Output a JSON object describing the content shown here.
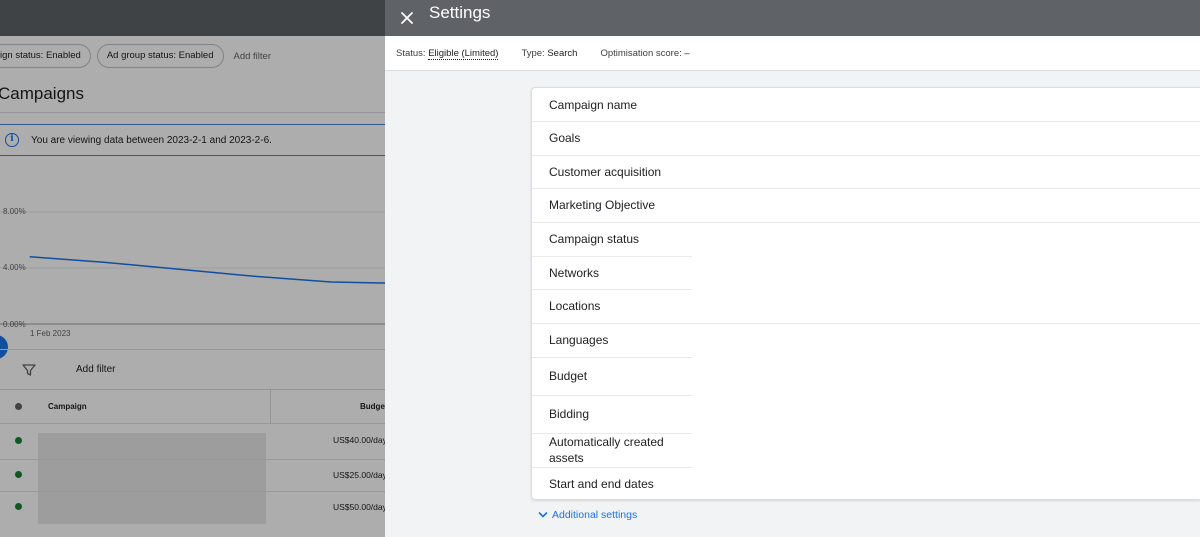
{
  "background": {
    "filters": [
      {
        "label": "Campaign status: Enabled",
        "display": "ign status: Enabled"
      },
      {
        "label": "Ad group status: Enabled",
        "display": "Ad group status: Enabled"
      }
    ],
    "add_filter_chip": "Add filter",
    "page_title": "Campaigns",
    "info_banner": "You are viewing data between 2023-2-1 and 2023-2-6.",
    "chart": {
      "yticks": [
        "8.00%",
        "4.00%",
        "0.00%"
      ],
      "xtick": "1 Feb 2023"
    },
    "table_toolbar": {
      "add_filter": "Add filter"
    },
    "table": {
      "headers": {
        "campaign": "Campaign",
        "budget": "Budget"
      },
      "rows": [
        {
          "budget": "US$40.00/day"
        },
        {
          "budget": "US$25.00/day"
        },
        {
          "budget": "US$50.00/day"
        }
      ]
    }
  },
  "chart_data": {
    "type": "line",
    "x": [
      "1 Feb 2023",
      "",
      "",
      "",
      "",
      ""
    ],
    "series": [
      {
        "values": [
          4.8,
          4.4,
          3.9,
          3.4,
          3.0,
          2.9
        ]
      }
    ],
    "ylim": [
      0,
      8
    ],
    "ylabel": "",
    "xlabel": "",
    "title": ""
  },
  "settings": {
    "title": "Settings",
    "status": {
      "label": "Status:",
      "value": "Eligible (Limited)"
    },
    "type": {
      "label": "Type:",
      "value": "Search"
    },
    "optimisation": {
      "label": "Optimisation score:",
      "value": "–"
    },
    "rows": [
      "Campaign name",
      "Goals",
      "Customer acquisition",
      "Marketing Objective",
      "Campaign status",
      "Networks",
      "Locations",
      "Languages",
      "Budget",
      "Bidding",
      "Automatically created assets",
      "Start and end dates"
    ],
    "additional_settings": "Additional settings"
  }
}
